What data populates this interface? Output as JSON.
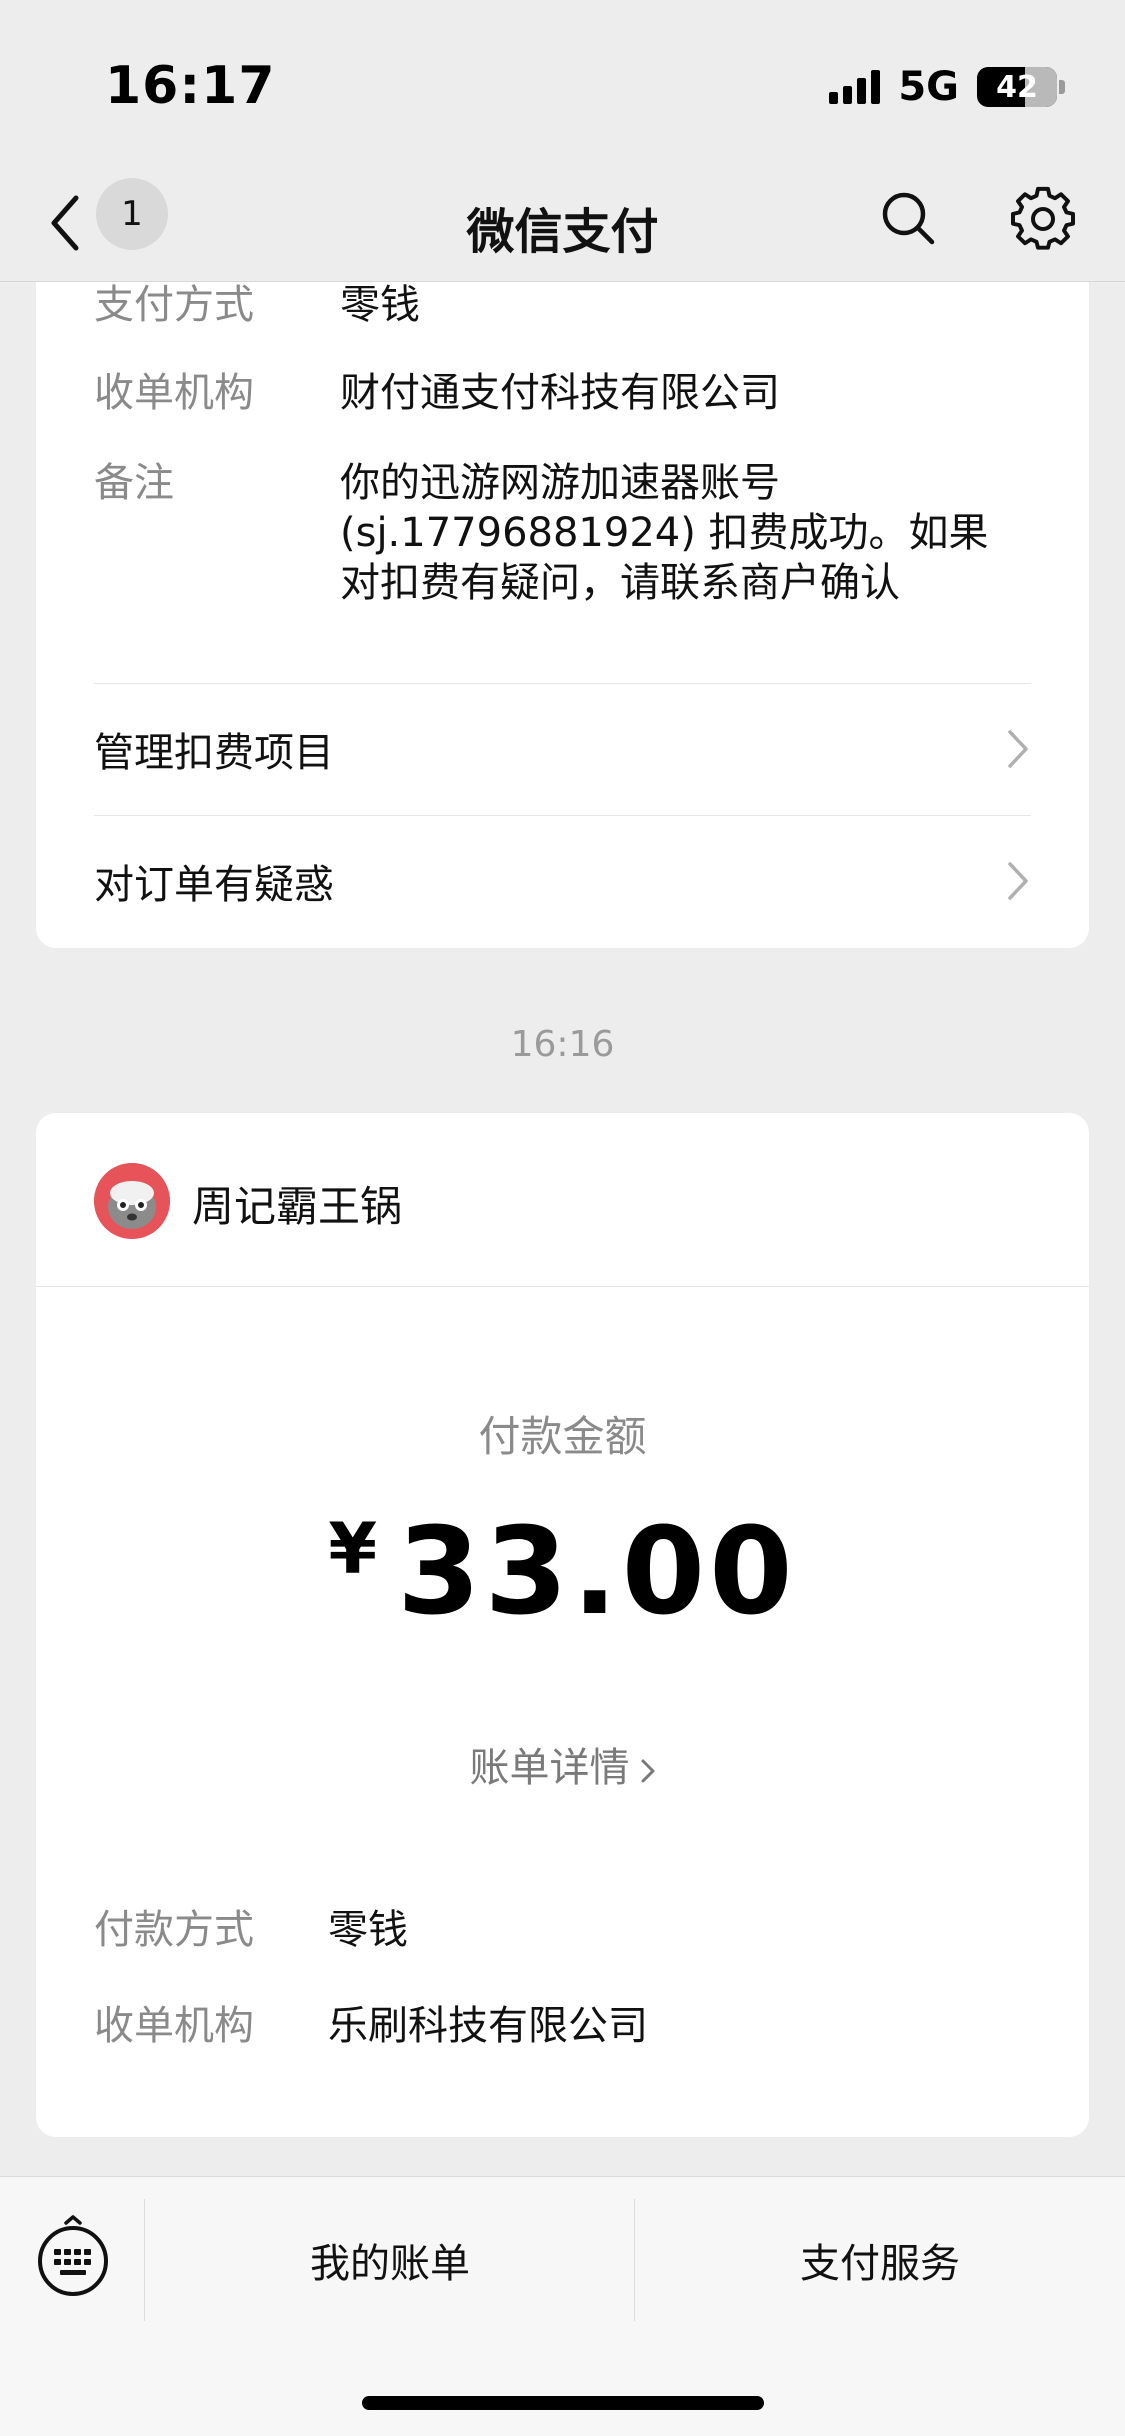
{
  "status_bar": {
    "time": "16:17",
    "network": "5G",
    "battery": "42"
  },
  "nav": {
    "badge_count": "1",
    "title": "微信支付"
  },
  "card1": {
    "rows": [
      {
        "label": "支付方式",
        "value": "零钱"
      },
      {
        "label": "收单机构",
        "value": "财付通支付科技有限公司"
      },
      {
        "label": "备注",
        "value_lines": [
          "你的迅游网游加速器账号",
          "(sj.17796881924) 扣费成功。如果",
          "对扣费有疑问，请联系商户确认"
        ]
      }
    ],
    "links": [
      "管理扣费项目",
      "对订单有疑惑"
    ]
  },
  "separator_time": "16:16",
  "card2": {
    "merchant_name": "周记霸王锅",
    "amount_label": "付款金额",
    "currency": "¥",
    "amount": "33.00",
    "bill_link": "账单详情",
    "rows": [
      {
        "label": "付款方式",
        "value": "零钱"
      },
      {
        "label": "收单机构",
        "value": "乐刷科技有限公司"
      }
    ]
  },
  "bottom_menu": {
    "left": "我的账单",
    "right": "支付服务"
  },
  "icons": [
    "back-icon",
    "search-icon",
    "gear-icon",
    "chevron-right-icon",
    "keyboard-icon",
    "merchant-avatar"
  ]
}
